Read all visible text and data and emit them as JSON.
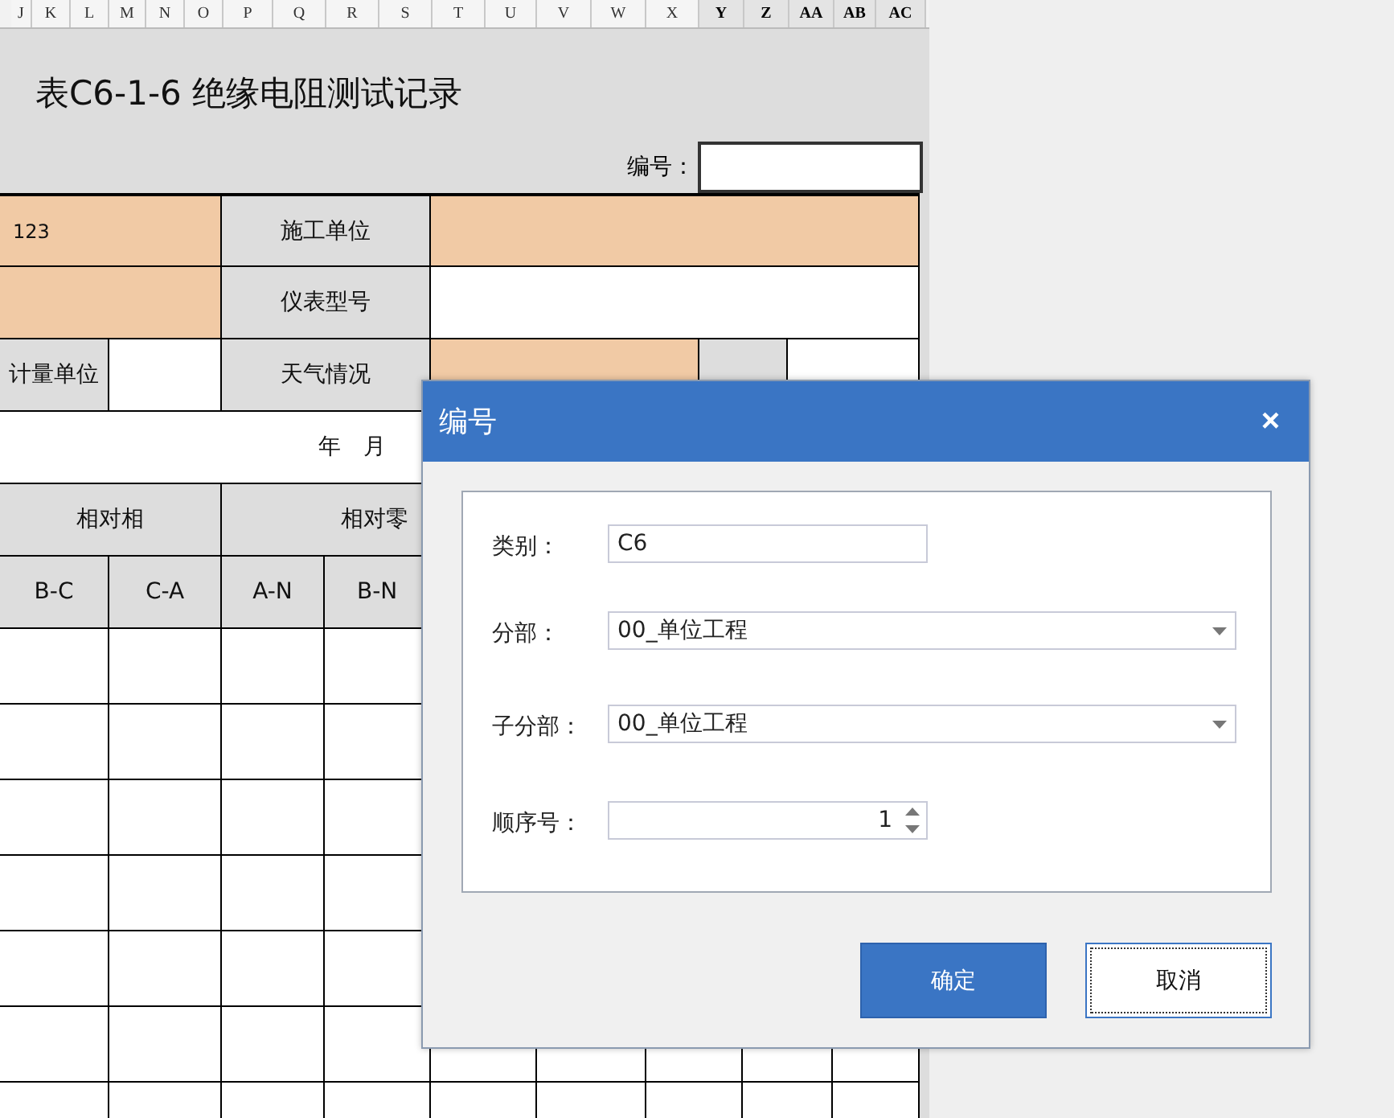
{
  "column_headers": [
    {
      "label": "J",
      "selected": false
    },
    {
      "label": "K",
      "selected": false
    },
    {
      "label": "L",
      "selected": false
    },
    {
      "label": "M",
      "selected": false
    },
    {
      "label": "N",
      "selected": false
    },
    {
      "label": "O",
      "selected": false
    },
    {
      "label": "P",
      "selected": false
    },
    {
      "label": "Q",
      "selected": false
    },
    {
      "label": "R",
      "selected": false
    },
    {
      "label": "S",
      "selected": false
    },
    {
      "label": "T",
      "selected": false
    },
    {
      "label": "U",
      "selected": false
    },
    {
      "label": "V",
      "selected": false
    },
    {
      "label": "W",
      "selected": false
    },
    {
      "label": "X",
      "selected": false
    },
    {
      "label": "Y",
      "selected": true
    },
    {
      "label": "Z",
      "selected": true
    },
    {
      "label": "AA",
      "selected": true
    },
    {
      "label": "AB",
      "selected": true
    },
    {
      "label": "AC",
      "selected": true
    }
  ],
  "sheet": {
    "title": "表C6-1-6 绝缘电阻测试记录",
    "number_label": "编号：",
    "rows": [
      {
        "kind": "form",
        "cells": [
          {
            "kind": "highlight",
            "text": "123"
          },
          {
            "kind": "label",
            "text": "施工单位"
          },
          {
            "kind": "highlight"
          }
        ]
      },
      {
        "kind": "form",
        "cells": [
          {
            "kind": "highlight"
          },
          {
            "kind": "label",
            "text": "仪表型号"
          },
          {
            "kind": "plain"
          }
        ]
      },
      {
        "kind": "form",
        "cells": [
          {
            "kind": "label",
            "text": "计量单位"
          },
          {
            "kind": "plain"
          },
          {
            "kind": "label",
            "text": "天气情况"
          },
          {
            "kind": "highlight"
          },
          {
            "kind": "label"
          },
          {
            "kind": "plain"
          }
        ]
      },
      {
        "kind": "date",
        "cells": [
          {
            "kind": "plain",
            "text": "年　月"
          }
        ]
      },
      {
        "kind": "form",
        "cells": [
          {
            "kind": "label",
            "text": "相对相"
          },
          {
            "kind": "label",
            "text": "相对零"
          }
        ]
      },
      {
        "kind": "form",
        "cells": [
          {
            "kind": "label",
            "text": "B-C"
          },
          {
            "kind": "label",
            "text": "C-A"
          },
          {
            "kind": "label",
            "text": "A-N"
          },
          {
            "kind": "label",
            "text": "B-N"
          }
        ]
      },
      {
        "kind": "blank"
      },
      {
        "kind": "blank"
      },
      {
        "kind": "blank"
      },
      {
        "kind": "blank"
      },
      {
        "kind": "blank"
      },
      {
        "kind": "blank"
      },
      {
        "kind": "blank"
      }
    ]
  },
  "dialog": {
    "title": "编号",
    "close": "×",
    "fields": [
      {
        "kind": "text",
        "label": "类别：",
        "value": "C6"
      },
      {
        "kind": "select",
        "label": "分部：",
        "value": "00_单位工程"
      },
      {
        "kind": "select",
        "label": "子分部：",
        "value": "00_单位工程"
      },
      {
        "kind": "spinner",
        "label": "顺序号：",
        "value": "1"
      }
    ],
    "buttons": [
      {
        "kind": "primary",
        "label": "确定",
        "focused": false
      },
      {
        "kind": "secondary",
        "label": "取消",
        "focused": true
      }
    ]
  }
}
